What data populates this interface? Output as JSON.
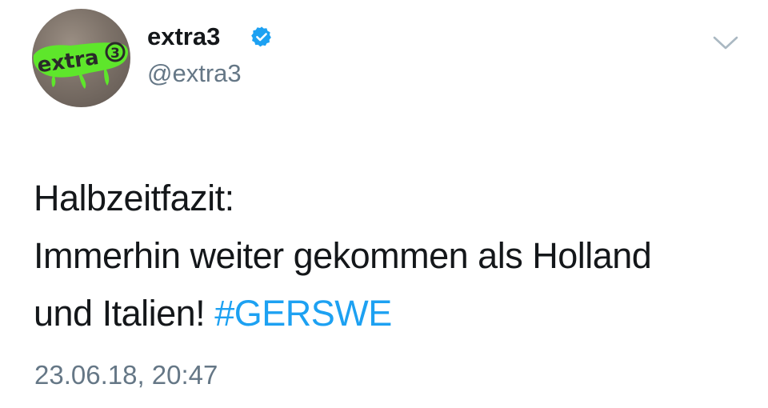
{
  "tweet": {
    "avatar_logo_text": "extra3",
    "display_name": "extra3",
    "handle": "@extra3",
    "verified": true,
    "verified_icon": "verified-badge-icon",
    "menu_icon": "chevron-down-icon",
    "text_line_1": "Halbzeitfazit:",
    "text_line_2": "Immerhin weiter gekommen als Holland",
    "text_line_3_prefix": "und Italien!",
    "hashtag": "#GERSWE",
    "timestamp": "23.06.18, 20:47"
  },
  "colors": {
    "name": "#14171a",
    "secondary": "#657786",
    "link": "#1da1f2",
    "verified": "#1da1f2",
    "logo_green": "#5ee62b"
  }
}
